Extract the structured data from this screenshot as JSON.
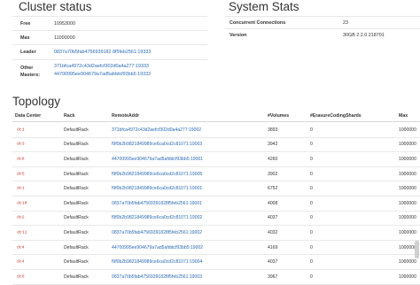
{
  "cluster": {
    "title": "Cluster status",
    "rows": [
      {
        "key": "Free",
        "value": "10953000",
        "link": false
      },
      {
        "key": "Max",
        "value": "11000000",
        "link": false
      },
      {
        "key": "Leader",
        "value": "0837a70b5fab4756939182 8f5feb2561:19333",
        "link": true
      }
    ],
    "other_masters_key": "Other Masters:",
    "other_masters": [
      "371bfca4972c43d2aefcf302d0a4a277:19333",
      "44700995ee904679a7ad5afddcf93bb5:19333"
    ]
  },
  "system": {
    "title": "System Stats",
    "rows": [
      {
        "key": "Concurrent Connections",
        "value": "23"
      },
      {
        "key": "Version",
        "value": "30GB 2.2.0.218701"
      }
    ]
  },
  "topology": {
    "title": "Topology",
    "columns": [
      "Data Center",
      "Rack",
      "RemoteAddr",
      "#Volumes",
      "#ErasureCodingShards",
      "Max"
    ],
    "rows": [
      {
        "dc": "dc1",
        "rack": "DefaultRack",
        "addr": "371bfca4972c43d2aefcf302d0a4a277:19002",
        "volumes": "3893",
        "ec": "0",
        "max": "1000000"
      },
      {
        "dc": "dc3",
        "rack": "DefaultRack",
        "addr": "f9f0b2b9821849989ce6ca0cd2c81071:19003",
        "volumes": "3942",
        "ec": "0",
        "max": "1000000"
      },
      {
        "dc": "dc8",
        "rack": "DefaultRack",
        "addr": "44700995ee904679a7ad5afddcf93bb5:19001",
        "volumes": "4260",
        "ec": "0",
        "max": "1000000"
      },
      {
        "dc": "dc5",
        "rack": "DefaultRack",
        "addr": "f9f0b2b9821849989ce6ca0cd2c81071:19005",
        "volumes": "3902",
        "ec": "0",
        "max": "1000000"
      },
      {
        "dc": "dc1",
        "rack": "DefaultRack",
        "addr": "f9f0b2b9821849989ce6ca0cd2c81071:19001",
        "volumes": "6752",
        "ec": "0",
        "max": "1000000"
      },
      {
        "dc": "dc10",
        "rack": "DefaultRack",
        "addr": "0837a70b5fab47569391828f5feb2561:19001",
        "volumes": "4008",
        "ec": "0",
        "max": "1000000"
      },
      {
        "dc": "dc2",
        "rack": "DefaultRack",
        "addr": "f9f0b2b9821849989ce6ca0cd2c81071:19002",
        "volumes": "4037",
        "ec": "0",
        "max": "1000000"
      },
      {
        "dc": "dc11",
        "rack": "DefaultRack",
        "addr": "0837a70b5fab47569391828f5feb2561:19002",
        "volumes": "4032",
        "ec": "0",
        "max": "1000000"
      },
      {
        "dc": "dc4",
        "rack": "DefaultRack",
        "addr": "44700995ee904679a7ad5afddcf93bb5:19002",
        "volumes": "4169",
        "ec": "0",
        "max": "1000000"
      },
      {
        "dc": "dc4",
        "rack": "DefaultRack",
        "addr": "f9f0b2b9821849989ce6ca0cd2c81071:19004",
        "volumes": "4037",
        "ec": "0",
        "max": "1000000"
      },
      {
        "dc": "dc6",
        "rack": "DefaultRack",
        "addr": "0837a70b5fab47569391828f5feb2561:19003",
        "volumes": "3967",
        "ec": "0",
        "max": "1000000"
      }
    ]
  }
}
